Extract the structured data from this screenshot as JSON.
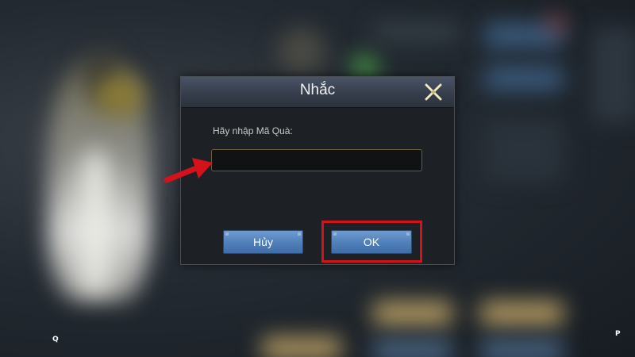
{
  "dialog": {
    "title": "Nhắc",
    "prompt_label": "Hãy nhập Mã Quà:",
    "input_value": "",
    "cancel_label": "Hủy",
    "ok_label": "OK"
  },
  "hud": {
    "hint_q": "Q",
    "hint_p": "P"
  },
  "annotations": {
    "color": "#d4121b"
  },
  "icons": {
    "close": "close-x-icon"
  }
}
